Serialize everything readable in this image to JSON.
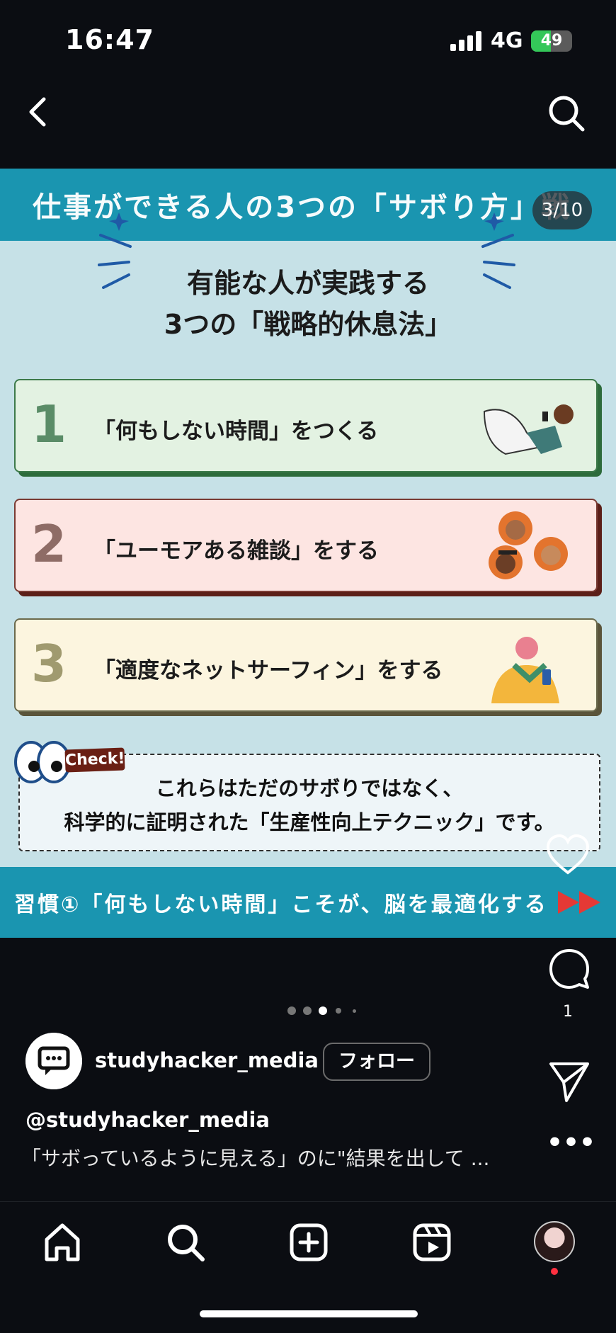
{
  "status_bar": {
    "time": "16:47",
    "network": "4G",
    "battery": "49",
    "battery_level": 0.49
  },
  "post": {
    "header_text": "仕事ができる人の3つの「サボり方」戦",
    "counter": "3/10",
    "headline_line1": "有能な人が実践する",
    "headline_line2": "3つの「戦略的休息法」",
    "items": [
      {
        "num": "1",
        "text": "「何もしない時間」をつくる"
      },
      {
        "num": "2",
        "text": "「ユーモアある雑談」をする"
      },
      {
        "num": "3",
        "text": "「適度なネットサーフィン」をする"
      }
    ],
    "check_badge": "Check!",
    "check_line1": "これらはただのサボりではなく、",
    "check_line2": "科学的に証明された「生産性向上テクニック」です。",
    "footer_text": "習慣①「何もしない時間」こそが、脳を最適化する"
  },
  "actions": {
    "comment_count": "1"
  },
  "account": {
    "username": "studyhacker_media",
    "follow_label": "フォロー",
    "handle": "@studyhacker_media",
    "caption": "「サボっているように見える」のに\"結果を出して ..."
  },
  "carousel": {
    "total_dots": 5,
    "active_index": 2
  },
  "colors": {
    "teal": "#1a95b0",
    "bg": "#0b0d12",
    "notify": "#ff3040"
  }
}
